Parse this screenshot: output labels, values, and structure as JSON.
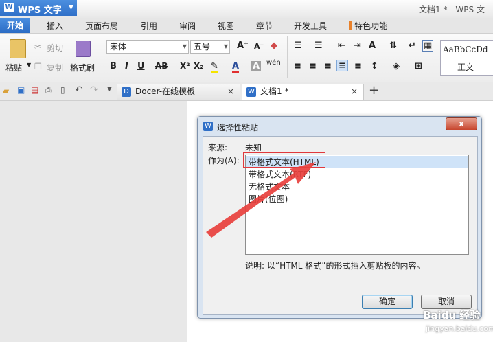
{
  "app": {
    "name": "WPS 文字",
    "window_title": "文档1 * - WPS 文"
  },
  "menu_tabs": [
    "开始",
    "插入",
    "页面布局",
    "引用",
    "审阅",
    "视图",
    "章节",
    "开发工具",
    "特色功能"
  ],
  "ribbon": {
    "paste": "粘贴",
    "cut": "剪切",
    "copy": "复制",
    "format_painter": "格式刷",
    "font_name": "宋体",
    "font_size": "五号",
    "style_preview": "AaBbCcDd",
    "style_name": "正文"
  },
  "doc_tabs": [
    {
      "label": "Docer-在线模板",
      "close": "×"
    },
    {
      "label": "文档1 *",
      "close": "×"
    }
  ],
  "add_tab": "+",
  "dialog": {
    "title": "选择性粘贴",
    "close": "x",
    "source_label": "来源:",
    "source_value": "未知",
    "as_label": "作为(A):",
    "options": [
      "带格式文本(HTML)",
      "带格式文本(RTF)",
      "无格式文本",
      "图片(位图)"
    ],
    "selected_index": 0,
    "description": "说明: 以“HTML 格式”的形式插入剪贴板的内容。",
    "ok": "确定",
    "cancel": "取消"
  },
  "watermark": {
    "text": "Baidu 经验",
    "url": "jingyan.baidu.com"
  },
  "colors": {
    "accent": "#2f6fc7",
    "highlight_box": "#e0393d",
    "arrow": "#e8403d"
  }
}
